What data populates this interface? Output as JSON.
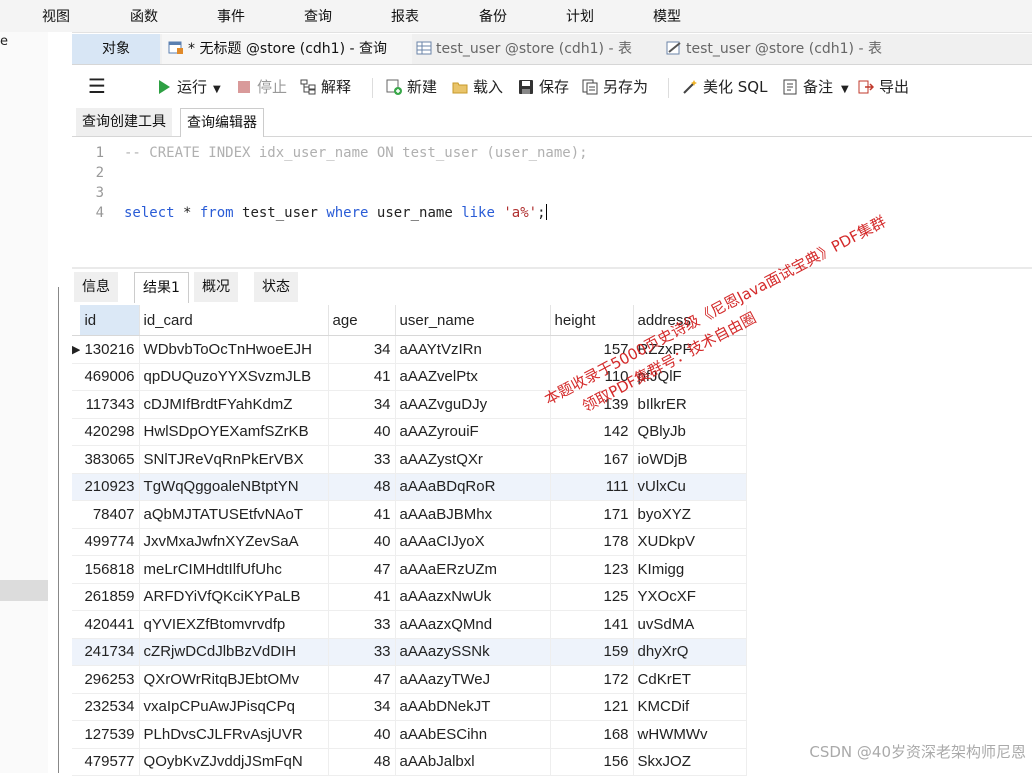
{
  "menu": [
    "视图",
    "函数",
    "事件",
    "查询",
    "报表",
    "备份",
    "计划",
    "模型"
  ],
  "left_strip_text": "e",
  "tabs": {
    "objects": "对象",
    "items": [
      {
        "label": "* 无标题 @store (cdh1) - 查询",
        "icon": "query-icon"
      },
      {
        "label": "test_user @store (cdh1) - 表",
        "icon": "table-icon"
      },
      {
        "label": "test_user @store (cdh1) - 表",
        "icon": "table-design-icon"
      }
    ]
  },
  "toolbar": {
    "run": "运行",
    "stop": "停止",
    "explain": "解释",
    "new": "新建",
    "load": "载入",
    "save": "保存",
    "save_as": "另存为",
    "beautify": "美化 SQL",
    "note": "备注",
    "export": "导出"
  },
  "subtabs": [
    "查询创建工具",
    "查询编辑器"
  ],
  "editor": {
    "line_numbers": [
      "1",
      "2",
      "3",
      "4"
    ],
    "line1_comment": "-- CREATE INDEX idx_user_name ON test_user (user_name);",
    "line4": {
      "kw_select": "select",
      "star": " * ",
      "kw_from": "from",
      "table": " test_user ",
      "kw_where": "where",
      "col": " user_name ",
      "kw_like": "like",
      "space": " ",
      "literal": "'a%'",
      "semicolon": ";"
    }
  },
  "result_tabs": [
    "信息",
    "结果1",
    "概况",
    "状态"
  ],
  "grid": {
    "columns": [
      "id",
      "id_card",
      "age",
      "user_name",
      "height",
      "address"
    ],
    "rows": [
      [
        "130216",
        "WDbvbToOcTnHwoeEJH",
        "34",
        "aAAYtVzIRn",
        "157",
        "RZzxPF"
      ],
      [
        "469006",
        "qpDUQuzoYYXSvzmJLB",
        "41",
        "aAAZvelPtx",
        "110",
        "pfJQlF"
      ],
      [
        "117343",
        "cDJMIfBrdtFYahKdmZ",
        "34",
        "aAAZvguDJy",
        "139",
        "bIlkrER"
      ],
      [
        "420298",
        "HwlSDpOYEXamfSZrKB",
        "40",
        "aAAZyrouiF",
        "142",
        "QBlyJb"
      ],
      [
        "383065",
        "SNlTJReVqRnPkErVBX",
        "33",
        "aAAZystQXr",
        "167",
        "ioWDjB"
      ],
      [
        "210923",
        "TgWqQggoaleNBtptYN",
        "48",
        "aAAaBDqRoR",
        "111",
        "vUlxCu"
      ],
      [
        "78407",
        "aQbMJTATUSEtfvNAoT",
        "41",
        "aAAaBJBMhx",
        "171",
        "byoXYZ"
      ],
      [
        "499774",
        "JxvMxaJwfnXYZevSaA",
        "40",
        "aAAaCIJyoX",
        "178",
        "XUDkpV"
      ],
      [
        "156818",
        "meLrCIMHdtIlfUfUhc",
        "47",
        "aAAaERzUZm",
        "123",
        "KImigg"
      ],
      [
        "261859",
        "ARFDYiVfQKciKYPaLB",
        "41",
        "aAAazxNwUk",
        "125",
        "YXOcXF"
      ],
      [
        "420441",
        "qYVIEXZfBtomvrvdfp",
        "33",
        "aAAazxQMnd",
        "141",
        "uvSdMA"
      ],
      [
        "241734",
        "cZRjwDCdJlbBzVdDIH",
        "33",
        "aAAazySSNk",
        "159",
        "dhyXrQ"
      ],
      [
        "296253",
        "QXrOWrRitqBJEbtOMv",
        "47",
        "aAAazyTWeJ",
        "172",
        "CdKrET"
      ],
      [
        "232534",
        "vxaIpCPuAwJPisqCPq",
        "34",
        "aAAbDNekJT",
        "121",
        "KMCDif"
      ],
      [
        "127539",
        "PLhDvsCJLFRvAsjUVR",
        "40",
        "aAAbESCihn",
        "168",
        "wHWMWv"
      ],
      [
        "479577",
        "QOybKvZJvddjJSmFqN",
        "48",
        "aAAbJalbxl",
        "156",
        "SkxJOZ"
      ]
    ]
  },
  "watermark": {
    "line1": "本题收录于5000页史诗级《尼恩Java面试宝典》PDF集群",
    "line2": "领取PDF集群号：技术自由圈"
  },
  "footer": "CSDN @40岁资深老架构师尼恩"
}
